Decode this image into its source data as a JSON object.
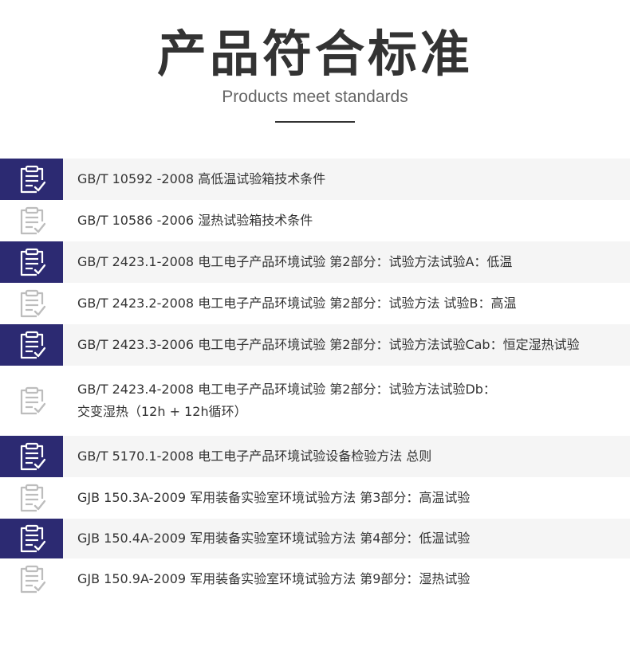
{
  "header": {
    "title": "产品符合标准",
    "subtitle": "Products meet standards"
  },
  "colors": {
    "accent": "#2c2a72",
    "row_shade": "#f5f5f5",
    "text": "#333333",
    "icon_muted": "#bdbdbd"
  },
  "standards": [
    {
      "icon": "clipboard-check-icon",
      "lines": [
        "GB/T 10592 -2008 高低温试验箱技术条件"
      ]
    },
    {
      "icon": "clipboard-check-icon",
      "lines": [
        "GB/T 10586 -2006 湿热试验箱技术条件"
      ]
    },
    {
      "icon": "clipboard-check-icon",
      "lines": [
        "GB/T 2423.1-2008 电工电子产品环境试验 第2部分：试验方法试验A：低温"
      ]
    },
    {
      "icon": "clipboard-check-icon",
      "lines": [
        "GB/T 2423.2-2008 电工电子产品环境试验 第2部分：试验方法 试验B：高温"
      ]
    },
    {
      "icon": "clipboard-check-icon",
      "lines": [
        "GB/T 2423.3-2006 电工电子产品环境试验 第2部分：试验方法试验Cab：恒定湿热试验"
      ]
    },
    {
      "icon": "clipboard-check-icon",
      "lines": [
        "GB/T 2423.4-2008 电工电子产品环境试验 第2部分：试验方法试验Db：",
        "交变湿热（12h + 12h循环）"
      ]
    },
    {
      "icon": "clipboard-check-icon",
      "lines": [
        "GB/T 5170.1-2008 电工电子产品环境试验设备检验方法 总则"
      ]
    },
    {
      "icon": "clipboard-check-icon",
      "lines": [
        "GJB 150.3A-2009 军用装备实验室环境试验方法 第3部分：高温试验"
      ]
    },
    {
      "icon": "clipboard-check-icon",
      "lines": [
        "GJB 150.4A-2009 军用装备实验室环境试验方法 第4部分：低温试验"
      ]
    },
    {
      "icon": "clipboard-check-icon",
      "lines": [
        "GJB 150.9A-2009 军用装备实验室环境试验方法 第9部分：湿热试验"
      ]
    }
  ]
}
